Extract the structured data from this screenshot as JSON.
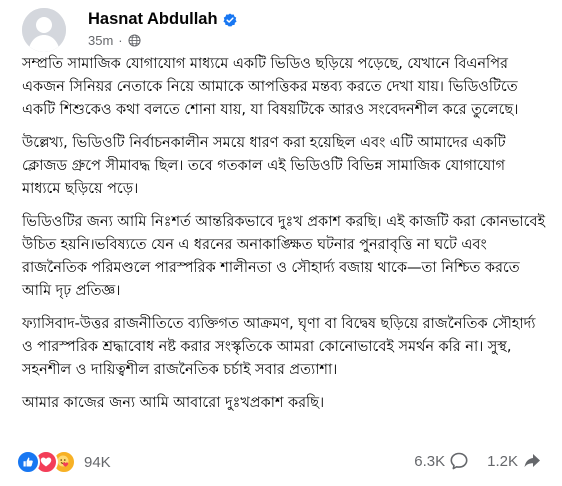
{
  "post": {
    "author": "Hasnat Abdullah",
    "timestamp": "35m",
    "separator": "·",
    "paragraphs": [
      "সম্প্রতি সামাজিক যোগাযোগ মাধ্যমে একটি ভিডিও ছড়িয়ে পড়েছে, যেখানে বিএনপির একজন সিনিয়র নেতাকে নিয়ে আমাকে আপত্তিকর মন্তব্য করতে দেখা যায়। ভিডিওটিতে একটি শিশুকেও কথা বলতে শোনা যায়, যা বিষয়টিকে আরও সংবেদনশীল করে তুলেছে।",
      "উল্লেখ্য, ভিডিওটি নির্বাচনকালীন সময়ে ধারণ করা হয়েছিল এবং এটি আমাদের একটি ক্লোজড গ্রুপে সীমাবদ্ধ ছিল। তবে গতকাল এই ভিডিওটি বিভিন্ন সামাজিক যোগাযোগ মাধ্যমে ছড়িয়ে পড়ে।",
      "ভিডিওটির জন্য আমি নিঃশর্ত আন্তরিকভাবে দুঃখ প্রকাশ করছি। এই কাজটি করা কোনভাবেই উচিত হয়নি।ভবিষ্যতে যেন এ ধরনের অনাকাঙ্ক্ষিত ঘটনার পুনরাবৃত্তি না ঘটে এবং রাজনৈতিক পরিমণ্ডলে পারস্পরিক শালীনতা ও সৌহার্দ্য বজায় থাকে—তা নিশ্চিত করতে আমি দৃঢ় প্রতিজ্ঞ।",
      "ফ্যাসিবাদ-উত্তর রাজনীতিতে ব্যক্তিগত আক্রমণ, ঘৃণা বা বিদ্বেষ ছড়িয়ে রাজনৈতিক সৌহার্দ্য ও পারস্পরিক শ্রদ্ধাবোধ নষ্ট করার সংস্কৃতিকে আমরা কোনোভাবেই সমর্থন করি না। সুস্থ, সহনশীল ও দায়িত্বশীল রাজনৈতিক চর্চাই সবার প্রত্যাশা।",
      "আমার কাজের জন্য আমি আবারো দুঃখপ্রকাশ করছি।"
    ]
  },
  "stats": {
    "reactions": "94K",
    "comments": "6.3K",
    "shares": "1.2K"
  },
  "icons": {
    "verified": "verified-badge-icon",
    "audience": "globe-icon",
    "reactions": [
      "like-icon",
      "love-icon",
      "care-icon"
    ],
    "comment": "comment-icon",
    "share": "share-icon"
  },
  "colors": {
    "brand": "#1877f2",
    "secondary_text": "#65676b",
    "love": "#f33e58",
    "care": "#f7b125"
  }
}
